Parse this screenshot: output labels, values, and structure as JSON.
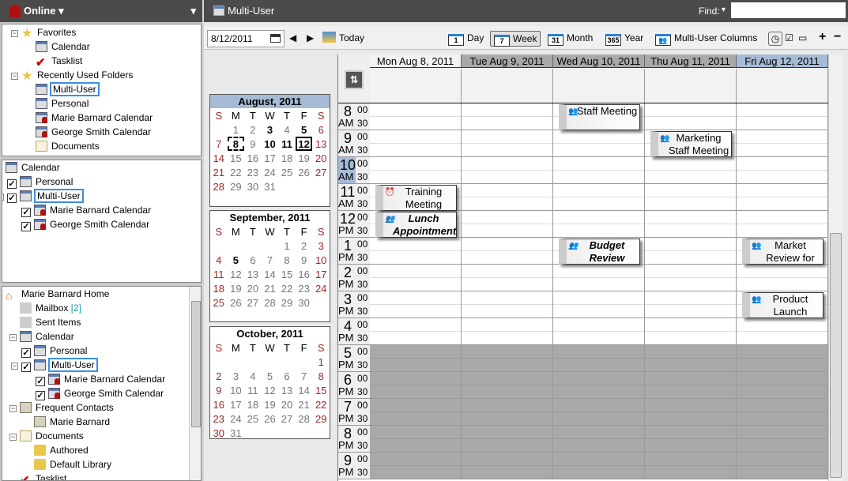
{
  "left_header": {
    "status": "Online"
  },
  "favorites_panel": [
    {
      "label": "Favorites",
      "lvl": 0,
      "icon": "star",
      "exp": "-"
    },
    {
      "label": "Calendar",
      "lvl": 1,
      "icon": "cal"
    },
    {
      "label": "Tasklist",
      "lvl": 1,
      "icon": "check"
    },
    {
      "label": "Recently Used Folders",
      "lvl": 0,
      "icon": "star",
      "exp": "-"
    },
    {
      "label": "Multi-User",
      "lvl": 1,
      "icon": "cal",
      "sel": true
    },
    {
      "label": "Personal",
      "lvl": 1,
      "icon": "cal"
    },
    {
      "label": "Marie Barnard Calendar",
      "lvl": 1,
      "icon": "user"
    },
    {
      "label": "George Smith Calendar",
      "lvl": 1,
      "icon": "user"
    },
    {
      "label": "Documents",
      "lvl": 1,
      "icon": "doc"
    }
  ],
  "calendar_panel": [
    {
      "label": "Calendar",
      "lvl": 0,
      "icon": "cal"
    },
    {
      "label": "Personal",
      "lvl": 1,
      "icon": "cal",
      "cb": true
    },
    {
      "label": "Multi-User",
      "lvl": 1,
      "icon": "cal",
      "cb": true,
      "exp": "-",
      "sel": true
    },
    {
      "label": "Marie Barnard Calendar",
      "lvl": 2,
      "icon": "user",
      "cb": true
    },
    {
      "label": "George Smith Calendar",
      "lvl": 2,
      "icon": "user",
      "cb": true
    }
  ],
  "home_panel": [
    {
      "label": "Marie Barnard Home",
      "lvl": 0,
      "icon": "home"
    },
    {
      "label": "Mailbox",
      "lvl": 1,
      "icon": "mail",
      "count": "[2]"
    },
    {
      "label": "Sent Items",
      "lvl": 1,
      "icon": "mail"
    },
    {
      "label": "Calendar",
      "lvl": 1,
      "icon": "cal",
      "exp": "-"
    },
    {
      "label": "Personal",
      "lvl": 2,
      "icon": "cal",
      "cb": true
    },
    {
      "label": "Multi-User",
      "lvl": 2,
      "icon": "cal",
      "cb": true,
      "exp": "-",
      "sel": true
    },
    {
      "label": "Marie Barnard Calendar",
      "lvl": 3,
      "icon": "user",
      "cb": true
    },
    {
      "label": "George Smith Calendar",
      "lvl": 3,
      "icon": "user",
      "cb": true
    },
    {
      "label": "Frequent Contacts",
      "lvl": 1,
      "icon": "contact",
      "exp": "-"
    },
    {
      "label": "Marie Barnard",
      "lvl": 2,
      "icon": "contact"
    },
    {
      "label": "Documents",
      "lvl": 1,
      "icon": "doc",
      "exp": "-"
    },
    {
      "label": "Authored",
      "lvl": 2,
      "icon": "folder"
    },
    {
      "label": "Default Library",
      "lvl": 2,
      "icon": "folder"
    },
    {
      "label": "Tasklist",
      "lvl": 1,
      "icon": "check"
    }
  ],
  "header": {
    "title": "Multi-User",
    "find_label": "Find:",
    "find_value": ""
  },
  "toolbar": {
    "date": "8/12/2011",
    "today": "Today",
    "views": [
      {
        "label": "Day",
        "num": "1"
      },
      {
        "label": "Week",
        "num": "7",
        "active": true
      },
      {
        "label": "Month",
        "num": "31"
      },
      {
        "label": "Year",
        "num": "365"
      },
      {
        "label": "Multi-User Columns",
        "num": "👥"
      }
    ],
    "zoom_in": "+",
    "zoom_out": "−"
  },
  "mini_calendars": [
    {
      "title": "August, 2011",
      "weeks": [
        [
          "",
          1,
          2,
          3,
          4,
          5,
          6
        ],
        [
          7,
          8,
          9,
          10,
          11,
          12,
          13
        ],
        [
          14,
          15,
          16,
          17,
          18,
          19,
          20
        ],
        [
          21,
          22,
          23,
          24,
          25,
          26,
          27
        ],
        [
          28,
          29,
          30,
          31,
          "",
          "",
          ""
        ]
      ],
      "bold": [
        3,
        5,
        8,
        10,
        11,
        12
      ],
      "today": 12,
      "selected": 8,
      "highlight": true
    },
    {
      "title": "September, 2011",
      "weeks": [
        [
          "",
          "",
          "",
          "",
          1,
          2,
          3
        ],
        [
          4,
          5,
          6,
          7,
          8,
          9,
          10
        ],
        [
          11,
          12,
          13,
          14,
          15,
          16,
          17
        ],
        [
          18,
          19,
          20,
          21,
          22,
          23,
          24
        ],
        [
          25,
          26,
          27,
          28,
          29,
          30,
          ""
        ]
      ],
      "bold": [
        5
      ]
    },
    {
      "title": "October, 2011",
      "weeks": [
        [
          "",
          "",
          "",
          "",
          "",
          "",
          1
        ],
        [
          2,
          3,
          4,
          5,
          6,
          7,
          8
        ],
        [
          9,
          10,
          11,
          12,
          13,
          14,
          15
        ],
        [
          16,
          17,
          18,
          19,
          20,
          21,
          22
        ],
        [
          23,
          24,
          25,
          26,
          27,
          28,
          29
        ],
        [
          30,
          31,
          "",
          "",
          "",
          "",
          ""
        ]
      ],
      "bold": []
    }
  ],
  "weekday_letters": [
    "S",
    "M",
    "T",
    "W",
    "T",
    "F",
    "S"
  ],
  "days": [
    "Mon Aug 8, 2011",
    "Tue Aug 9, 2011",
    "Wed Aug 10, 2011",
    "Thu Aug 11, 2011",
    "Fri Aug 12, 2011"
  ],
  "hours": [
    {
      "h": "8",
      "ap": "AM"
    },
    {
      "h": "9",
      "ap": "AM"
    },
    {
      "h": "10",
      "ap": "AM"
    },
    {
      "h": "11",
      "ap": "AM"
    },
    {
      "h": "12",
      "ap": "PM"
    },
    {
      "h": "1",
      "ap": "PM"
    },
    {
      "h": "2",
      "ap": "PM"
    },
    {
      "h": "3",
      "ap": "PM"
    },
    {
      "h": "4",
      "ap": "PM"
    },
    {
      "h": "5",
      "ap": "PM"
    },
    {
      "h": "6",
      "ap": "PM"
    },
    {
      "h": "7",
      "ap": "PM"
    },
    {
      "h": "8",
      "ap": "PM"
    },
    {
      "h": "9",
      "ap": "PM"
    }
  ],
  "minutes": [
    "00",
    "30"
  ],
  "work_end_hour_index": 9,
  "current_hour_index": 2,
  "events": [
    {
      "title": "Staff Meeting",
      "day": 2,
      "start": 8,
      "end": 9
    },
    {
      "title": "Marketing Staff Meeting",
      "day": 3,
      "start": 9,
      "end": 10
    },
    {
      "title": "Training Meeting",
      "day": 0,
      "start": 11,
      "end": 12,
      "alarm": true
    },
    {
      "title": "Lunch Appointment",
      "day": 0,
      "start": 12,
      "end": 13,
      "bold": true
    },
    {
      "title": "Budget Review",
      "day": 2,
      "start": 13,
      "end": 14,
      "bold": true
    },
    {
      "title": "Market Review for",
      "day": 4,
      "start": 13,
      "end": 14
    },
    {
      "title": "Product Launch",
      "day": 4,
      "start": 15,
      "end": 16
    }
  ],
  "colors": {
    "header_bg": "#4b4b4b",
    "today_header": "#a6bbd6",
    "offhours": "#a9a9a9"
  }
}
